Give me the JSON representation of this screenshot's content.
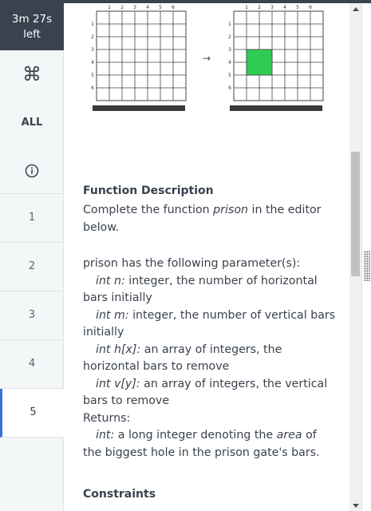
{
  "timer": {
    "line1": "3m 27s",
    "line2": "left"
  },
  "nav": {
    "command_glyph": "⌘",
    "all_label": "ALL",
    "questions": [
      "1",
      "2",
      "3",
      "4",
      "5"
    ],
    "active_question": "5"
  },
  "figure": {
    "col_labels": [
      "1",
      "2",
      "3",
      "4",
      "5",
      "6"
    ],
    "row_labels": [
      "1",
      "2",
      "3",
      "4",
      "5",
      "6"
    ],
    "hole_color": "#2ecc52",
    "arrow": "→"
  },
  "description": {
    "heading": "Function Description",
    "intro_a": "Complete the function ",
    "intro_fn": "prison",
    "intro_b": " in the editor below.",
    "params_intro": "prison has the following parameter(s):",
    "params": [
      {
        "name": "int n:",
        "desc": " integer, the number of horizontal bars initially"
      },
      {
        "name": "int m:",
        "desc": " integer, the number of vertical bars initially"
      },
      {
        "name": "int h[x]:",
        "desc": " an array of integers, the horizontal bars to remove"
      },
      {
        "name": "int v[y]:",
        "desc": " an array of integers, the vertical bars to remove"
      }
    ],
    "returns_label": "Returns:",
    "returns_type": "int:",
    "returns_a": " a long integer denoting the ",
    "returns_em": "area",
    "returns_b": " of the biggest hole in the prison gate's bars.",
    "constraints_heading": "Constraints"
  },
  "colors": {
    "sidebar_bg": "#f3f7f7",
    "timer_bg": "#39424e",
    "active_accent": "#3b6fe0"
  }
}
